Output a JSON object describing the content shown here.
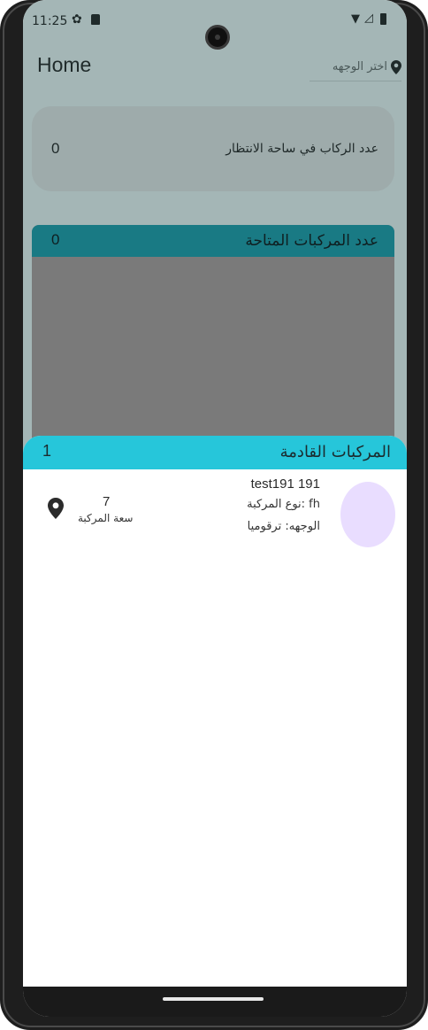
{
  "status_bar": {
    "time": "11:25",
    "icons": [
      "gear-icon",
      "sdcard-icon",
      "wifi-icon",
      "signal-icon",
      "battery-icon"
    ]
  },
  "app_bar": {
    "title": "Home",
    "destination_select": {
      "label": "اختر الوجهه",
      "icon": "map-pin-icon"
    }
  },
  "waiting_card": {
    "label": "عدد الركاب في ساحة الانتظار",
    "count": "0"
  },
  "available_vehicles": {
    "label": "عدد المركبات المتاحة",
    "count": "0"
  },
  "incoming_sheet": {
    "title": "المركبات القادمة",
    "count": "1",
    "vehicles": [
      {
        "name": "test191 191",
        "type": "fh :نوع المركبة",
        "destination": "الوجهه: ترقوميا",
        "capacity_value": "7",
        "capacity_label": "سعة المركبة",
        "icon": "location-pin-icon"
      }
    ]
  },
  "colors": {
    "sheet_header": "#26c6da",
    "available_header": "#197a84",
    "avatar": "#e9ddff",
    "scrim": "#a4b6b6"
  }
}
